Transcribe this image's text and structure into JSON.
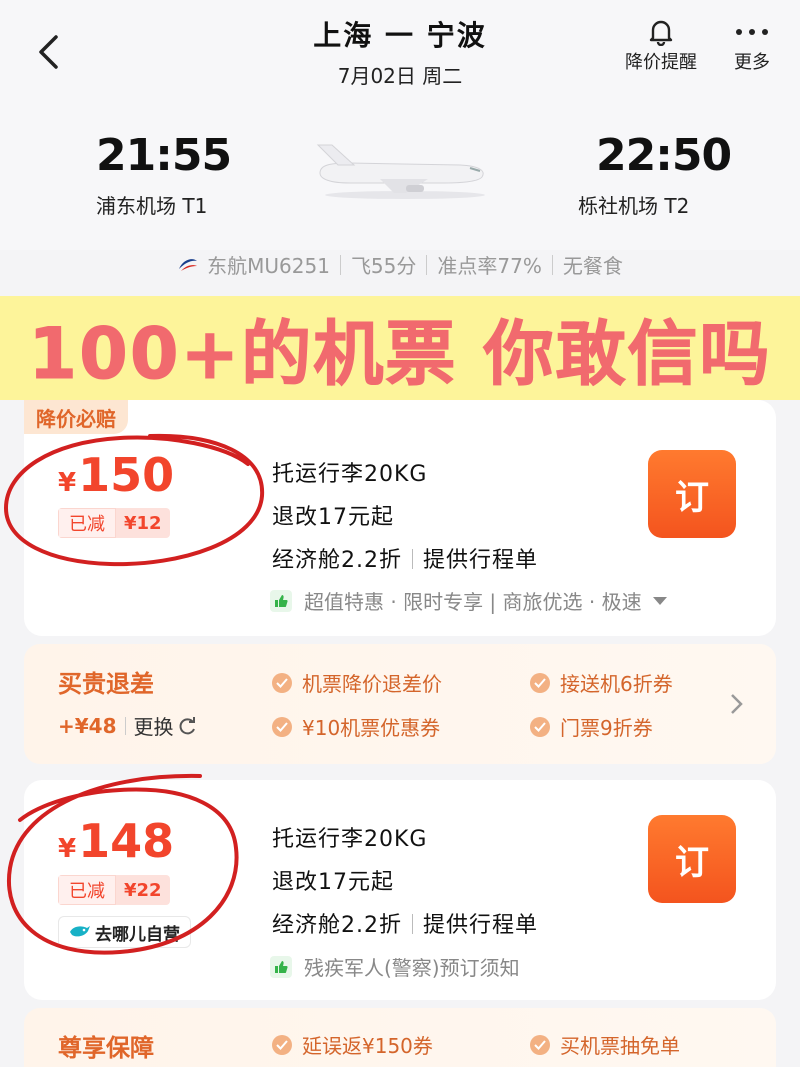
{
  "header": {
    "route": "上海 一 宁波",
    "date": "7月02日  周二",
    "price_alert_label": "降价提醒",
    "more_label": "更多"
  },
  "flight": {
    "depart_time": "21:55",
    "depart_airport": "浦东机场 T1",
    "arrive_time": "22:50",
    "arrive_airport": "栎社机场 T2",
    "airline": "东航MU6251",
    "duration": "飞55分",
    "on_time": "准点率77%",
    "meal": "无餐食"
  },
  "banner": {
    "text": "100+的机票 你敢信吗"
  },
  "offers": [
    {
      "tag": "降价必赔",
      "currency": "¥",
      "price": "150",
      "discount_label": "已减",
      "discount_value": "¥12",
      "baggage": "托运行李20KG",
      "refund": "退改17元起",
      "cabin": "经济舱2.2折",
      "itinerary": "提供行程单",
      "features": "超值特惠 · 限时专享 | 商旅优选 · 极速",
      "book_label": "订"
    },
    {
      "currency": "¥",
      "price": "148",
      "discount_label": "已减",
      "discount_value": "¥22",
      "seller": "去哪儿自营",
      "baggage": "托运行李20KG",
      "refund": "退改17元起",
      "cabin": "经济舱2.2折",
      "itinerary": "提供行程单",
      "features": "残疾军人(警察)预订须知",
      "book_label": "订"
    }
  ],
  "benefit1": {
    "title": "买贵退差",
    "extra": "+¥48",
    "change_label": "更换",
    "items": [
      "机票降价退差价",
      "接送机6折券",
      "¥10机票优惠券",
      "门票9折券"
    ]
  },
  "benefit2": {
    "title": "尊享保障",
    "items": [
      "延误返¥150券",
      "买机票抽免单"
    ]
  },
  "colors": {
    "accent": "#f2452c",
    "banner_bg": "#fdf49a",
    "banner_text": "#f16a6e",
    "book_button": "#f4541e"
  }
}
